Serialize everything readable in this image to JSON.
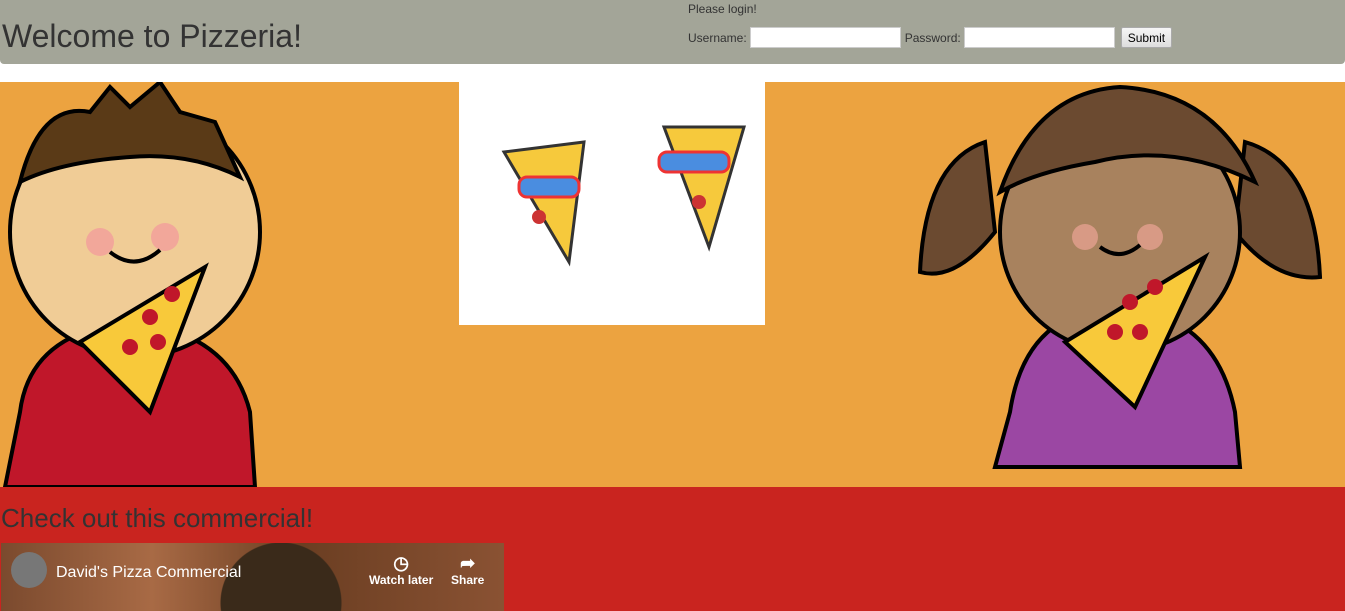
{
  "header": {
    "title": "Welcome to Pizzeria!",
    "login_prompt": "Please login!",
    "username_label": "Username:",
    "username_value": "",
    "password_label": "Password:",
    "password_value": "",
    "submit_label": "Submit"
  },
  "commercial": {
    "heading": "Check out this commercial!",
    "video_title": "David's Pizza Commercial",
    "watch_later": "Watch later",
    "share": "Share"
  },
  "colors": {
    "header": "#a3a598",
    "band": "#eca340",
    "red": "#c9241f"
  }
}
